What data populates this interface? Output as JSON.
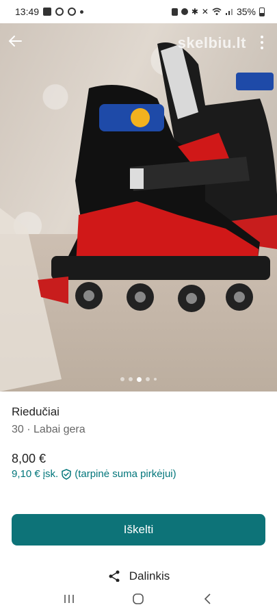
{
  "status_bar": {
    "time": "13:49",
    "battery": "35%"
  },
  "photo": {
    "watermark": "skelbiu.lt",
    "alt_subject": "inline-skates-photo",
    "pager_count": 5,
    "pager_active": 2
  },
  "listing": {
    "title": "Riedučiai",
    "subtitle": "30 · Labai gera",
    "price": "8,00 €",
    "price_incl_amount": "9,10 €",
    "price_incl_label": "įsk.",
    "price_incl_note": "(tarpinė suma pirkėjui)"
  },
  "actions": {
    "primary_button": "Iškelti",
    "share_label": "Dalinkis"
  },
  "colors": {
    "accent": "#0d7378",
    "accent_text": "#00757a"
  }
}
